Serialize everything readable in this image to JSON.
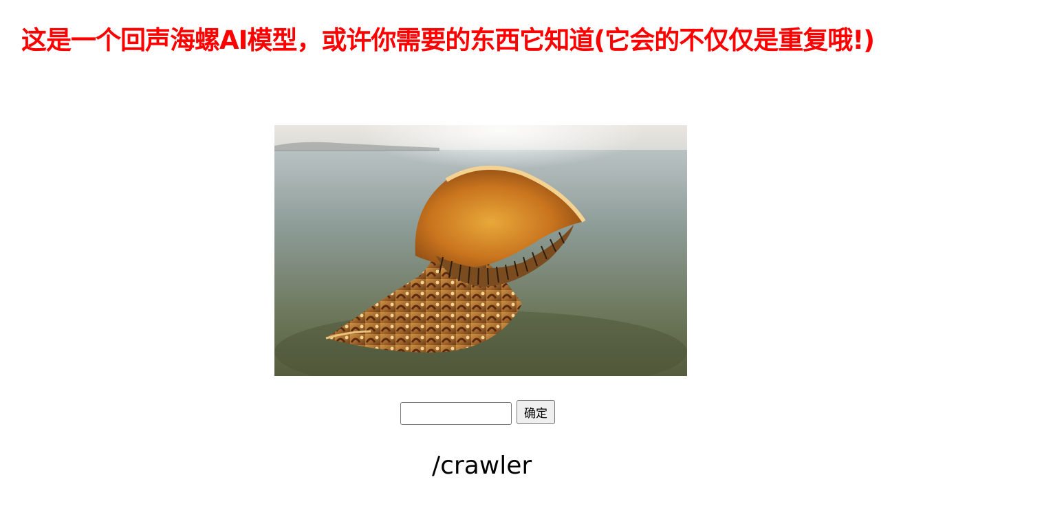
{
  "page": {
    "title": "这是一个回声海螺AI模型，或许你需要的东西它知道(它会的不仅仅是重复哦!)"
  },
  "form": {
    "input_value": "",
    "input_placeholder": "",
    "submit_label": "确定"
  },
  "result": {
    "text": "/crawler"
  },
  "colors": {
    "title": "#ff0000",
    "background": "#ffffff"
  }
}
